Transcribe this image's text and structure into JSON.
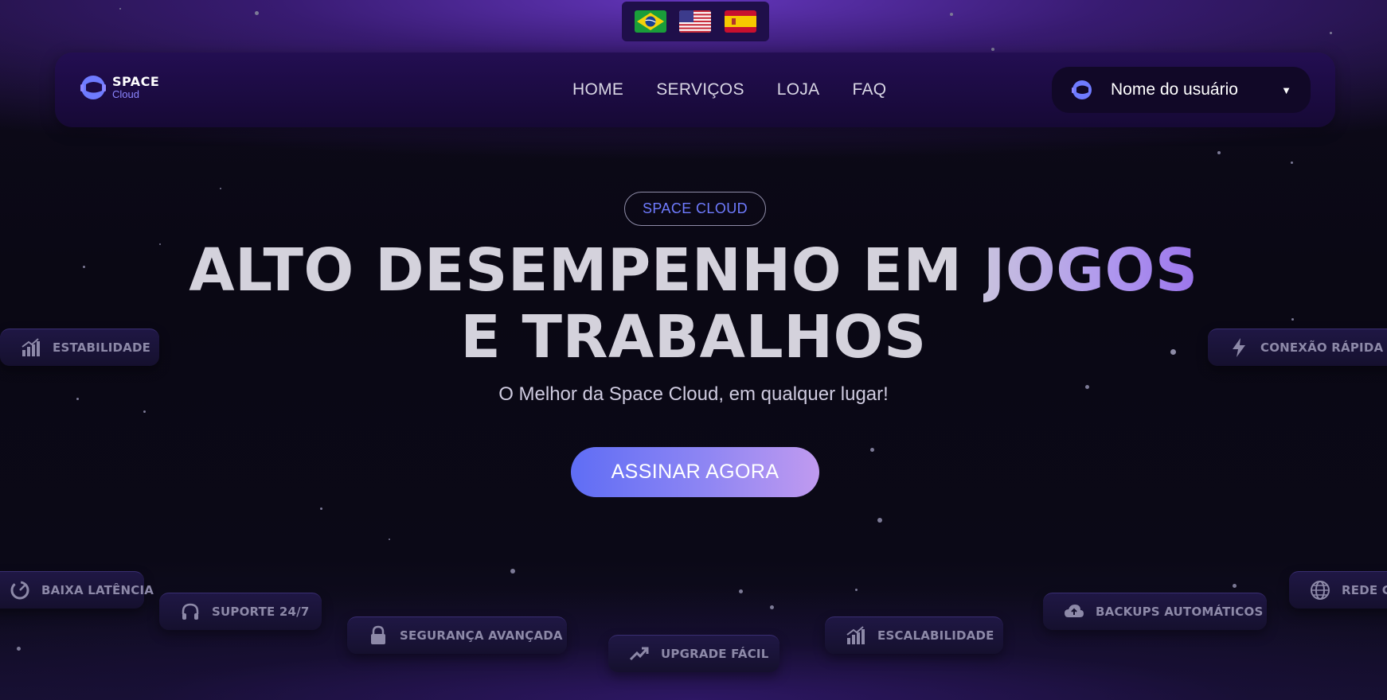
{
  "languages": [
    {
      "name": "Português (Brasil)",
      "icon": "brazil-flag-icon"
    },
    {
      "name": "English (US)",
      "icon": "usa-flag-icon"
    },
    {
      "name": "Español",
      "icon": "spain-flag-icon"
    }
  ],
  "navbar": {
    "logo_title": "SPACE",
    "logo_subtitle": "Cloud",
    "links": [
      "HOME",
      "SERVIÇOS",
      "LOJA",
      "FAQ"
    ],
    "user_name": "Nome do usuário",
    "user_caret": "▼"
  },
  "hero": {
    "badge": "SPACE CLOUD",
    "headline_line1_plain": "ALTO DESEMPENHO EM ",
    "headline_line1_accent": "JOGOS",
    "headline_line2": "E TRABALHOS",
    "subtitle": "O Melhor da Space Cloud, em qualquer lugar!",
    "cta_label": "ASSINAR AGORA"
  },
  "features": [
    {
      "label": "ESTABILIDADE",
      "icon": "bar-chart-icon"
    },
    {
      "label": "CONEXÃO RÁPIDA",
      "icon": "lightning-icon"
    },
    {
      "label": "BAIXA LATÊNCIA",
      "icon": "gauge-icon"
    },
    {
      "label": "SUPORTE 24/7",
      "icon": "headphones-icon"
    },
    {
      "label": "SEGURANÇA AVANÇADA",
      "icon": "lock-icon"
    },
    {
      "label": "UPGRADE FÁCIL",
      "icon": "trending-up-icon"
    },
    {
      "label": "ESCALABILIDADE",
      "icon": "bar-chart-icon"
    },
    {
      "label": "BACKUPS AUTOMÁTICOS",
      "icon": "cloud-upload-icon"
    },
    {
      "label": "REDE G",
      "icon": "globe-icon"
    }
  ],
  "colors": {
    "accent_blue": "#6f7bff",
    "cta_gradient_start": "#5f6df5",
    "cta_gradient_end": "#c09af0",
    "background": "#0a0814",
    "navbar": "#1d0b45"
  }
}
